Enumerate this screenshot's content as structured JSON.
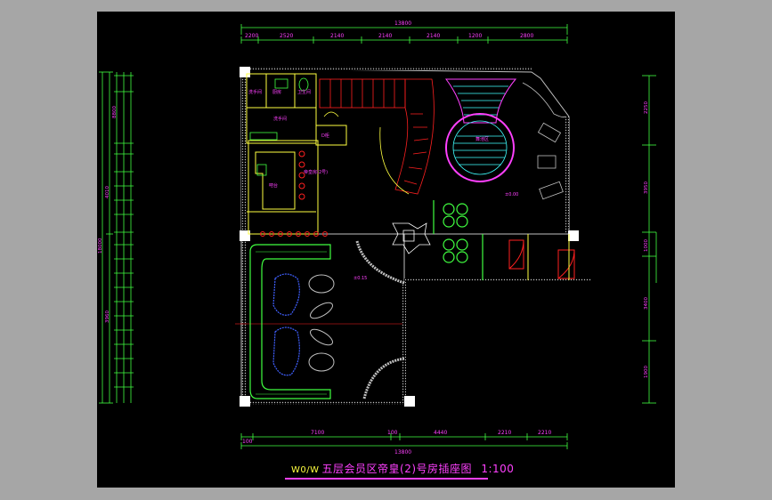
{
  "drawing": {
    "title_code": "W0/W",
    "title": "五层会员区帝皇(2)号房插座图",
    "scale": "1:100"
  },
  "dimensions": {
    "top_total": "13800",
    "top_segments": [
      "2200",
      "2520",
      "2140",
      "2140",
      "2140",
      "1200",
      "2800"
    ],
    "bottom_total": "13800",
    "bottom_segments": [
      "100",
      "7100",
      "100",
      "4440",
      "2210",
      "2210"
    ],
    "left_total": "18000",
    "left_overall": "8800",
    "left_upper": "4010",
    "left_lower": "3960",
    "right_segments": [
      "2250",
      "3950",
      "1000",
      "3400",
      "1900"
    ]
  },
  "rooms": {
    "kitchen_a": "洗手间",
    "kitchen_b": "厨房",
    "toilet": "卫生间",
    "wash": "洗手间",
    "bar_counter": "吧台",
    "storage": "D柜",
    "main_room": "帝皇房(2号)",
    "stage": "舞池区",
    "level_a": "±0.00",
    "level_b": "±0.15"
  }
}
